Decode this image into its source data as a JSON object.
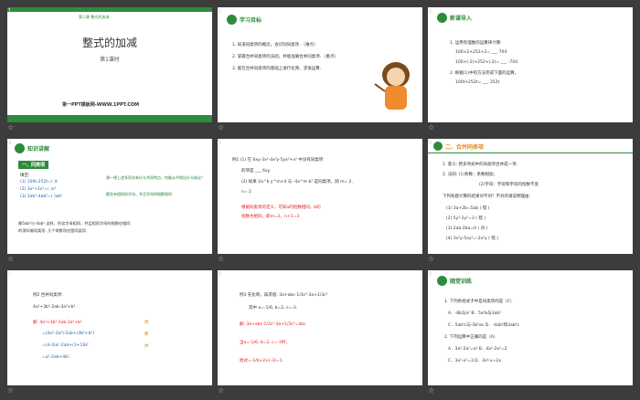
{
  "slides": [
    {
      "num": "1",
      "chapter_tag": "第二章 整式的加减",
      "title": "整式的加减",
      "subtitle": "第1课时",
      "website": "第一PPT模板网-WWW.1PPT.COM"
    },
    {
      "num": "2",
      "header": "学习目标",
      "items": [
        "1. 知道同类项的概念，会识别同类项．（难点）",
        "2. 掌握合并同类项的法则，并能准确合并同类项．（重点）",
        "3. 能在合并同类项的基础上进行化简、求值运算．"
      ]
    },
    {
      "num": "3",
      "header": "新课导入",
      "lines": [
        "1. 运用有理数的运算律计算:",
        "100×2+252×2= ___ 704",
        "100×(-2)+252×(-2)= ___ -704",
        "2. 根据(1)中的方法完成下面的运算，",
        "100t+252t= ___ 352t"
      ]
    },
    {
      "num": "4",
      "header": "知识讲解",
      "tag": "一、同类项",
      "lines": [
        "填空:",
        "(1) 100t-252t=( )t",
        "(2) 3x²+2x²=( )x²",
        "(3) 3ab²-4ab²=( )ab²",
        "像5ab²与-4ab² 这样，所含字母相同，并且相同字母的指数也相同",
        "的项叫做同类项. 几个常数项也是同类项."
      ],
      "notes": [
        "想一想上述多项式有什么共同特点，你能从中得出什么结论？",
        "都含有相同的字母，并且字母的指数相同"
      ]
    },
    {
      "num": "5",
      "lines": [
        "例1 (1) 在 6xy-3x²-4x²y-5yx²+x² 中没有同类项",
        "的项是 ___ 6xy",
        "(2) 如果 2a^b y^m+4 与 -4a^m b² 是同类项，则 m= 2 ,",
        "n= 2",
        "根据同类项的定义，可知a的指数相同，b的",
        "指数也相同，即m=2，n+1=3."
      ]
    },
    {
      "num": "6",
      "header": "二、合并同类项",
      "lines": [
        "1. 意义:    把多项式中的同类项合并成一项.",
        "2. 法则:   (1)系数：系数相加；",
        "(2)字母：字母和字母的指数不变.",
        "下列各题计算的结果对不对？不对的请说明理由:",
        "(1) 3a+2b=5ab  ( 错 )",
        "(2) 5y²-2y²=3  ( 错 )",
        "(3) 2ab-2ba=0  ( 对 )",
        "(4) 3x²y-5xy²=-2x²y  ( 错 )"
      ]
    },
    {
      "num": "7",
      "lines": [
        "例2 合并同类项:",
        "4a²+3b²-2ab-3a²+b².",
        "解: 4a²+3b²-2ab-3a²+b²",
        "=(4a²-3a²)-2ab+(3b²+b²)",
        "=(4-3)a²-2ab+(3+1)b²",
        "=a²-2ab+4b²."
      ],
      "side": [
        "找",
        "移",
        "并"
      ]
    },
    {
      "num": "8",
      "lines": [
        "例3 先化简，再求值: 3a+abc-1/3c²-3a+1/3c²",
        "其中 a=-1/6, b=2, c=-3.",
        "解: 3a+abc-1/3c²-3a+1/3c²=abc",
        "当a=-1/6, b=2, c=-3时，",
        "原式=-1/6×2×(-3)=1."
      ]
    },
    {
      "num": "9",
      "header": "随堂训练",
      "lines": [
        "1. 下列各组式子中是同类项的是（C）",
        "A．-8b与a²        B．5a²b与3ab²",
        "C．5ab²c与-3b²ac    D．-4ab²和3ab²c",
        "2. 下列运算中正确的是（A）",
        "A．3a²-2a²=a²       B．4a²-2a²=2",
        "C．3x²-x²=3       D．3x²-x=2x"
      ]
    }
  ]
}
